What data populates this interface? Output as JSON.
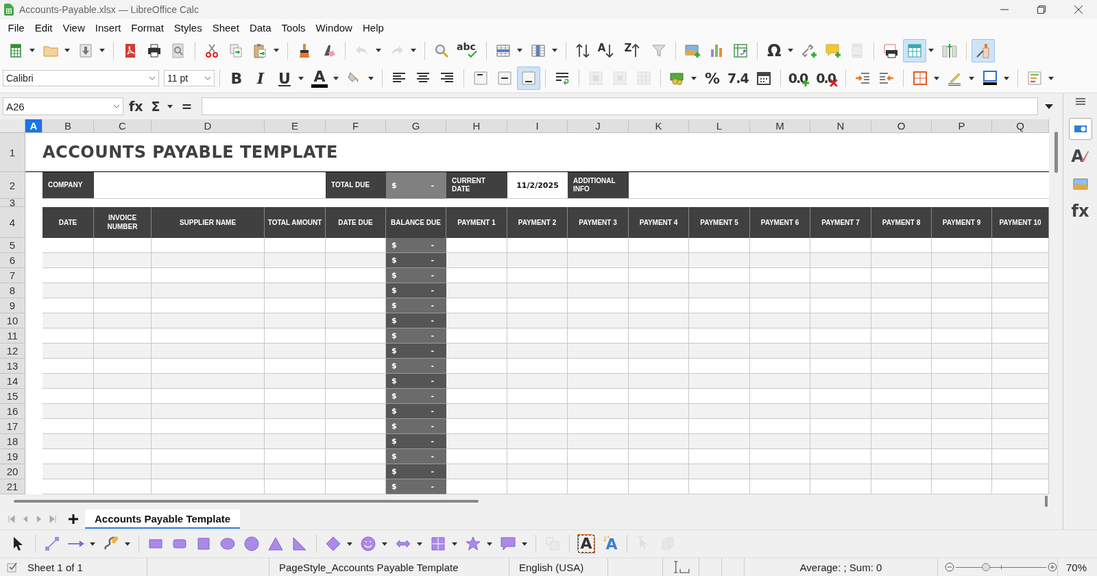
{
  "window": {
    "title": "Accounts-Payable.xlsx — LibreOffice Calc"
  },
  "menu": [
    "File",
    "Edit",
    "View",
    "Insert",
    "Format",
    "Styles",
    "Sheet",
    "Data",
    "Tools",
    "Window",
    "Help"
  ],
  "standard_toolbar": [
    [
      {
        "kind": "new",
        "dropdown": true,
        "on": false,
        "disabled": false
      },
      {
        "kind": "open",
        "dropdown": true,
        "on": false,
        "disabled": false
      },
      {
        "kind": "save",
        "dropdown": true,
        "on": false,
        "disabled": false
      }
    ],
    [
      {
        "kind": "pdf",
        "dropdown": false,
        "on": false,
        "disabled": false
      },
      {
        "kind": "print",
        "dropdown": false,
        "on": false,
        "disabled": false
      },
      {
        "kind": "preview",
        "dropdown": false,
        "on": false,
        "disabled": false
      }
    ],
    [
      {
        "kind": "cut",
        "dropdown": false,
        "on": false,
        "disabled": false
      },
      {
        "kind": "copy",
        "dropdown": false,
        "on": false,
        "disabled": false
      },
      {
        "kind": "paste",
        "dropdown": true,
        "on": false,
        "disabled": false
      }
    ],
    [
      {
        "kind": "clone",
        "dropdown": false,
        "on": false,
        "disabled": false
      },
      {
        "kind": "clear",
        "dropdown": false,
        "on": false,
        "disabled": false
      }
    ],
    [
      {
        "kind": "undo",
        "dropdown": true,
        "on": false,
        "disabled": true
      },
      {
        "kind": "redo",
        "dropdown": true,
        "on": false,
        "disabled": true
      }
    ],
    [
      {
        "kind": "find",
        "dropdown": false,
        "on": false,
        "disabled": false
      },
      {
        "kind": "spelling",
        "glyph": "abc",
        "dropdown": false,
        "on": false,
        "disabled": false
      }
    ],
    [
      {
        "kind": "rows",
        "dropdown": true,
        "on": false,
        "disabled": false
      },
      {
        "kind": "columns",
        "dropdown": true,
        "on": false,
        "disabled": false
      }
    ],
    [
      {
        "kind": "sort",
        "dropdown": false,
        "on": false,
        "disabled": false
      },
      {
        "kind": "ascending",
        "glyph": "A",
        "dropdown": false,
        "on": false,
        "disabled": false
      },
      {
        "kind": "descending",
        "glyph": "Z",
        "dropdown": false,
        "on": false,
        "disabled": false
      },
      {
        "kind": "filter",
        "dropdown": false,
        "on": false,
        "disabled": false
      }
    ],
    [
      {
        "kind": "image",
        "dropdown": false,
        "on": false,
        "disabled": false
      },
      {
        "kind": "chart",
        "dropdown": false,
        "on": false,
        "disabled": false
      },
      {
        "kind": "pivot",
        "dropdown": false,
        "on": false,
        "disabled": false
      }
    ],
    [
      {
        "kind": "symbol",
        "glyph": "Ω",
        "dropdown": true,
        "on": false,
        "disabled": false
      },
      {
        "kind": "hyperlink",
        "dropdown": false,
        "on": false,
        "disabled": false
      },
      {
        "kind": "comment",
        "dropdown": false,
        "on": false,
        "disabled": false
      },
      {
        "kind": "headers",
        "dropdown": false,
        "on": false,
        "disabled": true
      }
    ],
    [
      {
        "kind": "printrange",
        "dropdown": false,
        "on": false,
        "disabled": false
      },
      {
        "kind": "gridlines",
        "dropdown": true,
        "on": true,
        "disabled": false
      },
      {
        "kind": "freeze",
        "dropdown": false,
        "on": false,
        "disabled": false
      }
    ],
    [
      {
        "kind": "drawfunctions",
        "dropdown": false,
        "on": true,
        "disabled": false
      }
    ]
  ],
  "font_name": "Calibri",
  "font_size": "11 pt",
  "formatting_toolbar": [
    [
      {
        "kind": "bold",
        "glyph": "B",
        "dropdown": false,
        "on": false,
        "disabled": false
      },
      {
        "kind": "italic",
        "glyph": "I",
        "dropdown": false,
        "on": false,
        "disabled": false
      },
      {
        "kind": "underline",
        "glyph": "U",
        "dropdown": true,
        "on": false,
        "disabled": false
      },
      {
        "kind": "fontcolor",
        "glyph": "A",
        "dropdown": true,
        "on": false,
        "disabled": false
      },
      {
        "kind": "highlight",
        "dropdown": true,
        "on": false,
        "disabled": false
      }
    ],
    [
      {
        "kind": "alignleft",
        "dropdown": false,
        "on": false,
        "disabled": false
      },
      {
        "kind": "aligncenter",
        "dropdown": false,
        "on": false,
        "disabled": false
      },
      {
        "kind": "alignright",
        "dropdown": false,
        "on": false,
        "disabled": false
      }
    ],
    [
      {
        "kind": "aligntop",
        "dropdown": false,
        "on": false,
        "disabled": false
      },
      {
        "kind": "alignmiddle",
        "dropdown": false,
        "on": false,
        "disabled": false
      },
      {
        "kind": "alignbottom",
        "dropdown": false,
        "on": true,
        "disabled": false
      }
    ],
    [
      {
        "kind": "wrap",
        "dropdown": false,
        "on": false,
        "disabled": false
      }
    ],
    [
      {
        "kind": "merge",
        "dropdown": false,
        "on": false,
        "disabled": true
      },
      {
        "kind": "mergecenter",
        "dropdown": false,
        "on": false,
        "disabled": true
      },
      {
        "kind": "unmerge",
        "dropdown": false,
        "on": false,
        "disabled": true
      }
    ],
    [
      {
        "kind": "currency",
        "dropdown": true,
        "on": false,
        "disabled": false
      },
      {
        "kind": "percent",
        "glyph": "%",
        "dropdown": false,
        "on": false,
        "disabled": false
      },
      {
        "kind": "number",
        "glyph": "7.4",
        "dropdown": false,
        "on": false,
        "disabled": false
      },
      {
        "kind": "date",
        "dropdown": false,
        "on": false,
        "disabled": false
      }
    ],
    [
      {
        "kind": "adddecimal",
        "glyph": "0.0",
        "dropdown": false,
        "on": false,
        "disabled": false
      },
      {
        "kind": "deldecimal",
        "glyph": "0.0",
        "dropdown": false,
        "on": false,
        "disabled": false
      }
    ],
    [
      {
        "kind": "indent",
        "dropdown": false,
        "on": false,
        "disabled": false
      },
      {
        "kind": "outdent",
        "dropdown": false,
        "on": false,
        "disabled": false
      }
    ],
    [
      {
        "kind": "borders",
        "dropdown": true,
        "on": false,
        "disabled": false
      },
      {
        "kind": "borderstyle",
        "dropdown": true,
        "on": false,
        "disabled": false
      },
      {
        "kind": "bordercolor",
        "dropdown": true,
        "on": false,
        "disabled": false
      }
    ],
    [
      {
        "kind": "conditional",
        "dropdown": true,
        "on": false,
        "disabled": false
      }
    ]
  ],
  "formula_bar": {
    "name_box": "A26",
    "buttons": [
      {
        "glyph": "fx",
        "dropdown": false
      },
      {
        "glyph": "Σ",
        "dropdown": true
      },
      {
        "glyph": "=",
        "dropdown": false
      }
    ]
  },
  "columns": [
    {
      "label": "A",
      "selected": true
    },
    {
      "label": "B",
      "selected": false
    },
    {
      "label": "C",
      "selected": false
    },
    {
      "label": "D",
      "selected": false
    },
    {
      "label": "E",
      "selected": false
    },
    {
      "label": "F",
      "selected": false
    },
    {
      "label": "G",
      "selected": false
    },
    {
      "label": "H",
      "selected": false
    },
    {
      "label": "I",
      "selected": false
    },
    {
      "label": "J",
      "selected": false
    },
    {
      "label": "K",
      "selected": false
    },
    {
      "label": "L",
      "selected": false
    },
    {
      "label": "M",
      "selected": false
    },
    {
      "label": "N",
      "selected": false
    },
    {
      "label": "O",
      "selected": false
    },
    {
      "label": "P",
      "selected": false
    },
    {
      "label": "Q",
      "selected": false
    }
  ],
  "sheet": {
    "title": "ACCOUNTS PAYABLE TEMPLATE",
    "top_row_numbers": [
      "1",
      "2",
      "3",
      "4"
    ],
    "company_label": "COMPANY",
    "total_due_label": "TOTAL DUE",
    "total_due_currency": "$",
    "total_due_value": "-",
    "current_date_label": "CURRENT DATE",
    "current_date": "11/2/2025",
    "additional_info_label": "ADDITIONAL INFO",
    "headers": [
      "DATE",
      "INVOICE NUMBER",
      "SUPPLIER NAME",
      "TOTAL AMOUNT",
      "DATE DUE",
      "BALANCE DUE",
      "PAYMENT 1",
      "PAYMENT 2",
      "PAYMENT 3",
      "PAYMENT 4",
      "PAYMENT 5",
      "PAYMENT 6",
      "PAYMENT 7",
      "PAYMENT 8",
      "PAYMENT 9",
      "PAYMENT 10"
    ],
    "rows": [
      {
        "number": "5",
        "balance_currency": "$",
        "balance_value": "-"
      },
      {
        "number": "6",
        "balance_currency": "$",
        "balance_value": "-"
      },
      {
        "number": "7",
        "balance_currency": "$",
        "balance_value": "-"
      },
      {
        "number": "8",
        "balance_currency": "$",
        "balance_value": "-"
      },
      {
        "number": "9",
        "balance_currency": "$",
        "balance_value": "-"
      },
      {
        "number": "10",
        "balance_currency": "$",
        "balance_value": "-"
      },
      {
        "number": "11",
        "balance_currency": "$",
        "balance_value": "-"
      },
      {
        "number": "12",
        "balance_currency": "$",
        "balance_value": "-"
      },
      {
        "number": "13",
        "balance_currency": "$",
        "balance_value": "-"
      },
      {
        "number": "14",
        "balance_currency": "$",
        "balance_value": "-"
      },
      {
        "number": "15",
        "balance_currency": "$",
        "balance_value": "-"
      },
      {
        "number": "16",
        "balance_currency": "$",
        "balance_value": "-"
      },
      {
        "number": "17",
        "balance_currency": "$",
        "balance_value": "-"
      },
      {
        "number": "18",
        "balance_currency": "$",
        "balance_value": "-"
      },
      {
        "number": "19",
        "balance_currency": "$",
        "balance_value": "-"
      },
      {
        "number": "20",
        "balance_currency": "$",
        "balance_value": "-"
      },
      {
        "number": "21",
        "balance_currency": "$",
        "balance_value": "-"
      }
    ]
  },
  "sidebar_tabs": [
    {
      "kind": "properties",
      "selected": true
    },
    {
      "kind": "styles",
      "glyph": "A",
      "selected": false
    },
    {
      "kind": "gallery",
      "selected": false
    },
    {
      "kind": "functions",
      "glyph": "fx",
      "selected": false
    }
  ],
  "sheet_tabs": [
    {
      "label": "Accounts Payable Template",
      "selected": true
    }
  ],
  "drawing_toolbar": [
    [
      {
        "kind": "select",
        "dropdown": false,
        "on": false,
        "disabled": false
      }
    ],
    [
      {
        "kind": "line",
        "dropdown": false,
        "on": false,
        "disabled": false
      },
      {
        "kind": "arrowline",
        "dropdown": true,
        "on": false,
        "disabled": false
      },
      {
        "kind": "curve",
        "dropdown": true,
        "on": false,
        "disabled": false
      }
    ],
    [
      {
        "kind": "rect",
        "dropdown": false,
        "on": false,
        "disabled": false
      },
      {
        "kind": "roundrect",
        "dropdown": false,
        "on": false,
        "disabled": false
      },
      {
        "kind": "square",
        "dropdown": false,
        "on": false,
        "disabled": false
      },
      {
        "kind": "ellipse",
        "dropdown": false,
        "on": false,
        "disabled": false
      },
      {
        "kind": "circle",
        "dropdown": false,
        "on": false,
        "disabled": false
      },
      {
        "kind": "triangle",
        "dropdown": false,
        "on": false,
        "disabled": false
      },
      {
        "kind": "righttriangle",
        "dropdown": false,
        "on": false,
        "disabled": false
      }
    ],
    [
      {
        "kind": "diamond",
        "dropdown": true,
        "on": false,
        "disabled": false
      },
      {
        "kind": "smiley",
        "dropdown": true,
        "on": false,
        "disabled": false
      },
      {
        "kind": "doublearrow",
        "dropdown": true,
        "on": false,
        "disabled": false
      },
      {
        "kind": "flowchart",
        "dropdown": true,
        "on": false,
        "disabled": false
      },
      {
        "kind": "star",
        "dropdown": true,
        "on": false,
        "disabled": false
      },
      {
        "kind": "callout",
        "dropdown": true,
        "on": false,
        "disabled": false
      }
    ],
    [
      {
        "kind": "points",
        "dropdown": false,
        "on": false,
        "disabled": true
      }
    ],
    [
      {
        "kind": "fontworkbox",
        "glyph": "A",
        "dropdown": false,
        "on": false,
        "disabled": false
      },
      {
        "kind": "fontwork",
        "glyph": "A",
        "dropdown": false,
        "on": false,
        "disabled": false
      }
    ],
    [
      {
        "kind": "extrusion",
        "dropdown": false,
        "on": false,
        "disabled": true
      },
      {
        "kind": "threed",
        "dropdown": false,
        "on": false,
        "disabled": true
      }
    ]
  ],
  "status_bar": {
    "sheet": "Sheet 1 of 1",
    "page_style": "PageStyle_Accounts Payable Template",
    "language": "English (USA)",
    "selection_summary": "Average: ; Sum: 0",
    "zoom_slider": {
      "level": 0.33
    },
    "zoom": "70%"
  }
}
